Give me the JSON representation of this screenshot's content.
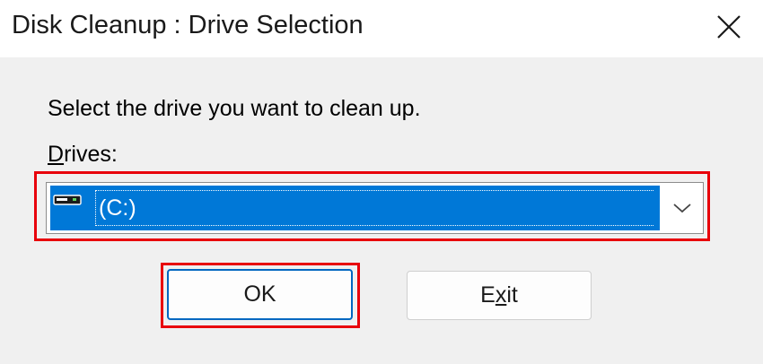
{
  "window": {
    "title": "Disk Cleanup : Drive Selection",
    "close_icon": "close-icon"
  },
  "prompt": "Select the drive you want to clean up.",
  "drives": {
    "label_accel": "D",
    "label_rest": "rives:",
    "selected": "(C:)",
    "icon": "drive-icon",
    "chevron_icon": "chevron-down-icon"
  },
  "buttons": {
    "ok": "OK",
    "exit_pre": "E",
    "exit_accel": "x",
    "exit_post": "it"
  },
  "colors": {
    "selection": "#0078d7",
    "highlight": "#e8000b",
    "focus_border": "#0067c0"
  }
}
